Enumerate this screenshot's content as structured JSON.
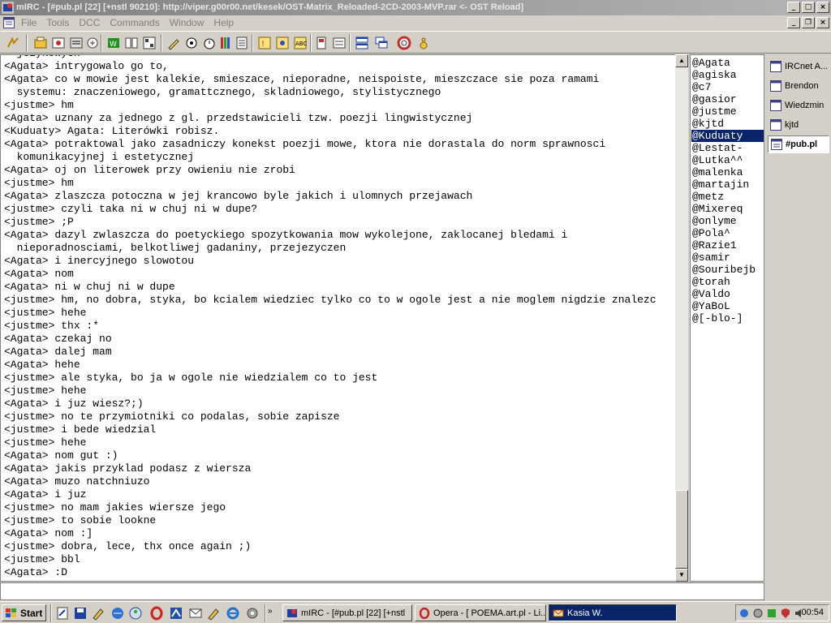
{
  "window": {
    "title": "mIRC - [#pub.pl [22] [+nstl 90210]: http://viper.g00r00.net/kesek/OST-Matrix_Reloaded-2CD-2003-MVP.rar <- OST Reload]"
  },
  "menu": {
    "items": [
      "File",
      "Tools",
      "DCC",
      "Commands",
      "Window",
      "Help"
    ]
  },
  "chat": {
    "lines": [
      "  jezykowych",
      "<Agata> intrygowalo go to,",
      "<Agata> co w mowie jest kalekie, smieszace, nieporadne, neispoiste, mieszczace sie poza ramami",
      "  systemu: znaczeniowego, gramattcznego, skladniowego, stylistycznego",
      "<justme> hm",
      "<Agata> uznany za jednego z gl. przedstawicieli tzw. poezji lingwistycznej",
      "<Kuduaty> Agata: Literówki robisz.",
      "<Agata> potraktowal jako zasadniczy konekst poezji mowe, ktora nie dorastala do norm sprawnosci",
      "  komunikacyjnej i estetycznej",
      "<Agata> oj on literowek przy owieniu nie zrobi",
      "<justme> hm",
      "<Agata> zlaszcza potoczna w jej krancowo byle jakich i ulomnych przejawach",
      "<justme> czyli taka ni w chuj ni w dupe?",
      "<justme> ;P",
      "<Agata> dazyl zwlaszcza do poetyckiego spozytkowania mow wykolejone, zaklocanej bledami i",
      "  nieporadnosciami, belkotliwej gadaniny, przejezyczen",
      "<Agata> i inercyjnego slowotou",
      "<Agata> nom",
      "<Agata> ni w chuj ni w dupe",
      "<justme> hm, no dobra, styka, bo kcialem wiedziec tylko co to w ogole jest a nie moglem nigdzie znalezc",
      "<justme> hehe",
      "<justme> thx :*",
      "<Agata> czekaj no",
      "<Agata> dalej mam",
      "<Agata> hehe",
      "<justme> ale styka, bo ja w ogole nie wiedzialem co to jest",
      "<justme> hehe",
      "<Agata> i juz wiesz?;)",
      "<justme> no te przymiotniki co podalas, sobie zapisze",
      "<justme> i bede wiedzial",
      "<justme> hehe",
      "<Agata> nom gut :)",
      "<Agata> jakis przyklad podasz z wiersza",
      "<Agata> muzo natchniuzo",
      "<Agata> i juz",
      "<justme> no mam jakies wiersze jego",
      "<justme> to sobie lookne",
      "<Agata> nom :]",
      "<justme> dobra, lece, thx once again ;)",
      "<justme> bbl",
      "<Agata> :D"
    ]
  },
  "nicklist": {
    "selected": "@Kuduaty",
    "nicks": [
      "@Agata",
      "@agiska",
      "@c7",
      "@gasior",
      "@justme",
      "@kjtd",
      "@Kuduaty",
      "@Lestat-",
      "@Lutka^^",
      "@malenka",
      "@martajin",
      "@metz",
      "@Mixereq",
      "@onlyme",
      "@Pola^",
      "@Razie1",
      "@samir",
      "@Souribejb",
      "@torah",
      "@Valdo",
      "@YaBoL",
      "@[-blo-]"
    ]
  },
  "switchbar": {
    "items": [
      "IRCnet A...",
      "Brendon",
      "Wiedzmin",
      "kjtd",
      "#pub.pl"
    ],
    "active": "#pub.pl"
  },
  "taskbar": {
    "start_label": "Start",
    "tasks": [
      "mIRC - [#pub.pl [22] [+nstl",
      "Opera - [ POEMA.art.pl - Li...",
      "Kasia W."
    ],
    "active_task": "Kasia W.",
    "clock": "00:54"
  },
  "colors": {
    "selection": "#0a246a",
    "chrome": "#d4d0c8",
    "titlebar_inactive": "#808080"
  }
}
